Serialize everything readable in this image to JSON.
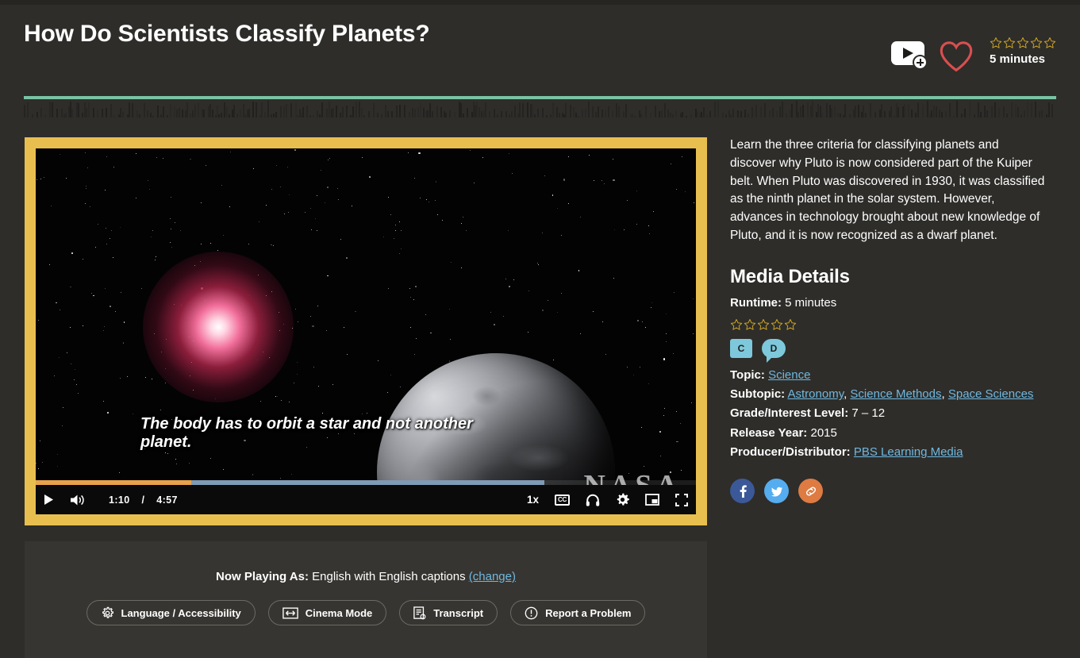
{
  "header": {
    "title": "How Do Scientists Classify Planets?",
    "playlist_icon": "add-to-playlist-icon",
    "favorite_icon": "heart-icon",
    "stars_count": 5,
    "stars_filled": 0,
    "runtime_label": "5 minutes"
  },
  "colors": {
    "page_bg": "#2e2d2a",
    "panel_bg": "#373531",
    "divider": "#79c2a4",
    "player_border": "#e8bf4f",
    "link": "#6fb8e0",
    "star_outline": "#c9a227",
    "heart": "#d94f4f",
    "badge": "#7ec8db",
    "progress_played": "#e8a34a",
    "progress_buffer": "#7f9ab5",
    "facebook": "#3b5998",
    "twitter": "#55acee",
    "link_share": "#dd7b43"
  },
  "video": {
    "caption_text": "The body has to orbit a star and not another planet.",
    "watermark": "NASA",
    "current_time": "1:10",
    "time_separator": "/",
    "duration": "4:57",
    "progress_percent": 23.5,
    "buffer_percent": 77,
    "playback_speed": "1x",
    "controls": {
      "play_label": "play-button",
      "volume_label": "volume-button",
      "speed_label": "1x",
      "cc_label": "CC",
      "audio_description_label": "audio-description-button",
      "settings_label": "settings-button",
      "pip_label": "picture-in-picture-button",
      "fullscreen_label": "fullscreen-button"
    }
  },
  "lower_panel": {
    "now_playing_label": "Now Playing As:",
    "now_playing_value": "English with English captions",
    "change_link": "(change)",
    "buttons": [
      {
        "label": "Language / Accessibility",
        "icon": "gear-icon"
      },
      {
        "label": "Cinema Mode",
        "icon": "expand-horizontal-icon"
      },
      {
        "label": "Transcript",
        "icon": "transcript-icon"
      },
      {
        "label": "Report a Problem",
        "icon": "exclamation-circle-icon"
      }
    ]
  },
  "sidebar": {
    "description": "Learn the three criteria for classifying planets and discover why Pluto is now considered part of the Kuiper belt. When Pluto was discovered in 1930, it was classified as the ninth planet in the solar system. However, advances in technology brought about new knowledge of Pluto, and it is now recognized as a dwarf planet.",
    "details_title": "Media Details",
    "runtime_label": "Runtime:",
    "runtime_value": "5 minutes",
    "stars_count": 5,
    "stars_filled": 0,
    "badges": [
      {
        "text": "C",
        "name": "closed-captions-badge"
      },
      {
        "text": "D",
        "name": "audio-description-badge"
      }
    ],
    "topic_label": "Topic:",
    "topic_value": "Science",
    "subtopic_label": "Subtopic:",
    "subtopics": [
      "Astronomy",
      "Science Methods",
      "Space Sciences"
    ],
    "grade_label": "Grade/Interest Level:",
    "grade_value": "7 – 12",
    "release_label": "Release Year:",
    "release_value": "2015",
    "producer_label": "Producer/Distributor:",
    "producer_value": "PBS Learning Media",
    "social": [
      {
        "name": "facebook-share-button",
        "glyph": "f"
      },
      {
        "name": "twitter-share-button",
        "glyph": "t"
      },
      {
        "name": "copy-link-button",
        "glyph": "link"
      }
    ]
  }
}
